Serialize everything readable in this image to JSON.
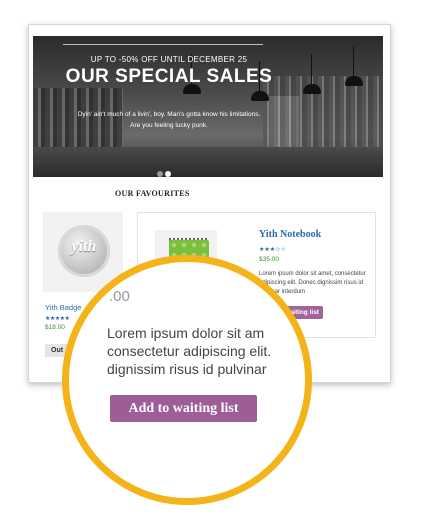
{
  "banner": {
    "promo": "UP TO -50% OFF UNTIL DECEMBER 25",
    "title": "OUR SPECIAL SALES",
    "subtitle_line1": "Dyin' ain't much of a livin', boy. Man's gotta know his limitations.",
    "subtitle_line2": "Are you feeling lucky punk."
  },
  "favourites": {
    "heading": "OUR FAVOURITES",
    "products": [
      {
        "name": "Yith Badge",
        "logo_text": "yith",
        "price": "$18.00",
        "rating": 5,
        "stars": "★★★★★",
        "button": "Out"
      },
      {
        "name": "Yith Notebook",
        "logo_text": "yith",
        "price": "$35.00",
        "rating": 3,
        "stars": "★★★☆☆",
        "description": "Lorem ipsum dolor sit amet, consectetur adipiscing elit. Donec dignissim risus id pulvinar interdum",
        "button": "Add to waiting list"
      }
    ]
  },
  "zoom": {
    "price": ".00",
    "line1": "Lorem ipsum dolor sit am",
    "line2": "consectetur adipiscing elit.",
    "line3": "dignissim risus id pulvinar",
    "button": "Add to waiting list"
  },
  "colors": {
    "accent": "#f5b31a",
    "button": "#a0649a",
    "link": "#2a6aa8",
    "price": "#3c8d3c"
  }
}
